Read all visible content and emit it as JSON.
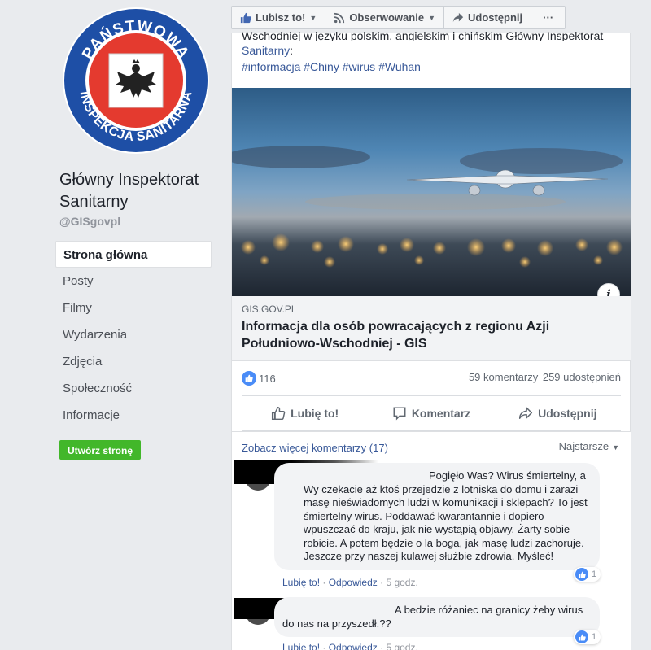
{
  "sidebar": {
    "logo_alt": "PAŃSTWOWA INSPEKCJA SANITARNA",
    "page_name": "Główny Inspektorat Sanitarny",
    "handle": "@GISgovpl",
    "nav": [
      {
        "label": "Strona główna",
        "active": true
      },
      {
        "label": "Posty"
      },
      {
        "label": "Filmy"
      },
      {
        "label": "Wydarzenia"
      },
      {
        "label": "Zdjęcia"
      },
      {
        "label": "Społeczność"
      },
      {
        "label": "Informacje"
      }
    ],
    "create_page": "Utwórz stronę"
  },
  "actionbar": {
    "like": "Lubisz to!",
    "follow": "Obserwowanie",
    "share": "Udostępnij",
    "more": "···"
  },
  "post": {
    "text_cut": "Wschodniej w języku polskim, angielskim i chińskim Główny Inspektorat",
    "link_name": "Sanitarny",
    "text_after": ":",
    "hashtags": "#informacja #Chiny #wirus #Wuhan",
    "link_domain": "GIS.GOV.PL",
    "link_title": "Informacja dla osób powracających z regionu Azji Południowo-Wschodniej - GIS",
    "info_icon": "i",
    "likes_count": "116",
    "comments_count": "59 komentarzy",
    "shares_count": "259 udostępnień",
    "actions": {
      "like": "Lubię to!",
      "comment": "Komentarz",
      "share": "Udostępnij"
    }
  },
  "comments_section": {
    "more_comments": "Zobacz więcej komentarzy (17)",
    "sort_label": "Najstarsze",
    "comments": [
      {
        "text": "Pogięło Was? Wirus śmiertelny, a Wy czekacie aż ktoś przejedzie z lotniska do domu i zarazi masę nieświadomych ludzi w komunikacji i sklepach? To jest śmiertelny wirus. Poddawać kwarantannie i dopiero wpuszczać do kraju, jak nie wystąpią objawy. Żarty sobie robicie. A potem będzie o la boga, jak masę ludzi zachoruje. Jeszcze przy naszej kulawej służbie zdrowia. Myśleć!",
        "like": "Lubię to!",
        "reply": "Odpowiedz",
        "time": "5 godz.",
        "reactions": "1"
      },
      {
        "text": "A bedzie różaniec na granicy żeby wirus do nas na przyszedł.??",
        "like": "Lubię to!",
        "reply": "Odpowiedz",
        "time": "5 godz.",
        "reactions": "1"
      }
    ]
  },
  "colors": {
    "fb_blue": "#4267b2",
    "link": "#385898",
    "green": "#42b72a",
    "logo_red": "#e43a2f",
    "logo_blue": "#1e4fa6"
  }
}
